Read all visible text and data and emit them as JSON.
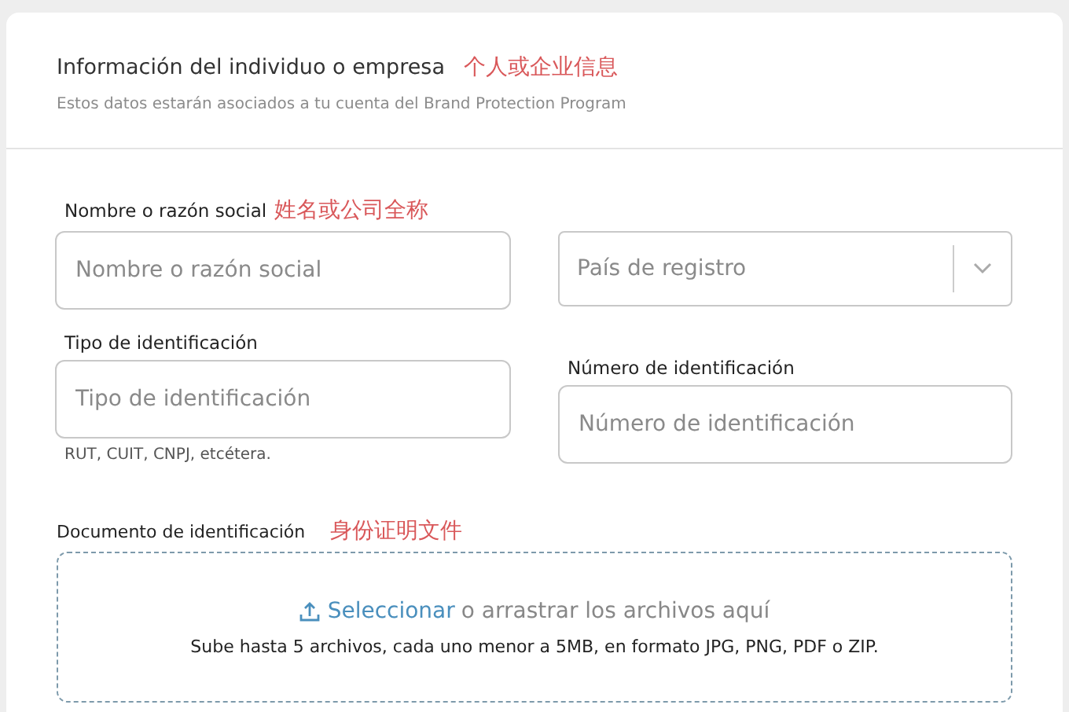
{
  "header": {
    "title": "Información del individuo o empresa",
    "title_note": "个人或企业信息",
    "subtitle": "Estos datos estarán asociados a tu cuenta del Brand Protection Program"
  },
  "fields": [
    {
      "kind": "input",
      "label": "Nombre o razón social",
      "note": "姓名或公司全称",
      "placeholder": "Nombre o razón social"
    },
    {
      "kind": "select",
      "placeholder": "País de registro"
    },
    {
      "kind": "input",
      "label": "Tipo de identificación",
      "placeholder": "Tipo de identificación",
      "hint": "RUT, CUIT, CNPJ, etcétera."
    },
    {
      "kind": "input",
      "label": "Número de identificación",
      "placeholder": "Número de identificación"
    }
  ],
  "upload": {
    "label": "Documento de identificación",
    "note": "身份证明文件",
    "link": "Seleccionar",
    "text": "o arrastrar los archivos aquí",
    "info": "Sube hasta 5 archivos, cada uno menor a 5MB, en formato JPG, PNG, PDF o ZIP."
  }
}
